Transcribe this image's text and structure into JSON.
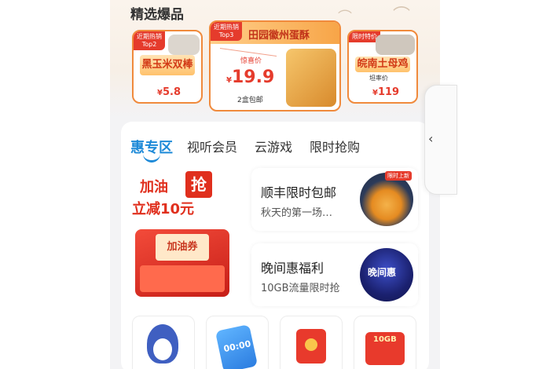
{
  "section": {
    "title": "精选爆品"
  },
  "products": [
    {
      "tag_line1": "近期热销",
      "tag_line2": "Top2",
      "name": "黑玉米双棒",
      "price_symbol": "¥",
      "price": "5.8"
    },
    {
      "tag_line1": "近期热销",
      "tag_line2": "Top3",
      "name": "田园徽州蛋酥",
      "price_label": "惊喜价",
      "price_symbol": "¥",
      "price": "19.9",
      "note": "2盒包邮"
    },
    {
      "tag_line1": "限时特价",
      "name": "皖南土母鸡",
      "note": "坦率价",
      "price_symbol": "¥",
      "price": "119"
    }
  ],
  "tabs": [
    {
      "label": "惠专区",
      "active": true
    },
    {
      "label": "视听会员",
      "active": false
    },
    {
      "label": "云游戏",
      "active": false
    },
    {
      "label": "限时抢购",
      "active": false
    }
  ],
  "fuel_banner": {
    "headline_line1": "加油",
    "badge": "抢",
    "headline_line2": "立减10元",
    "coupon": "加油券"
  },
  "promos": [
    {
      "title": "顺丰限时包邮",
      "subtitle": "秋天的第一场…",
      "badge": "限时上新"
    },
    {
      "title": "晚间惠福利",
      "subtitle": "10GB流量限时抢",
      "logo": "晚间惠"
    }
  ],
  "bottom_icons": [
    {
      "name": "penguin-icon"
    },
    {
      "name": "phone-clock-icon",
      "text": "00:00"
    },
    {
      "name": "red-envelope-icon"
    },
    {
      "name": "gift-box-icon",
      "text": "10GB"
    }
  ],
  "collapse_arrow": "‹",
  "colors": {
    "accent_blue": "#1e8ad8",
    "price_red": "#e53b2c",
    "card_orange": "#f08a3c"
  }
}
